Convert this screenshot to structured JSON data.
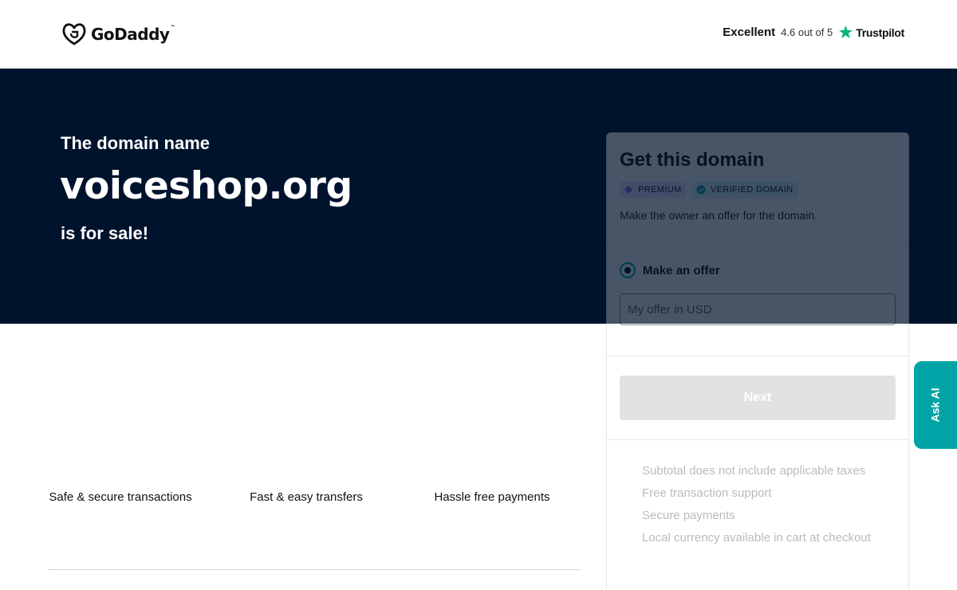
{
  "header": {
    "logo_text": "GoDaddy",
    "logo_tm": "™",
    "rating_label": "Excellent",
    "rating_score": "4.6 out of 5",
    "trustpilot": "Trustpilot"
  },
  "hero": {
    "pre": "The domain name",
    "domain": "voiceshop.org",
    "post": "is for sale!"
  },
  "features": [
    "Safe & secure transactions",
    "Fast & easy transfers",
    "Hassle free payments"
  ],
  "card": {
    "title": "Get this domain",
    "badges": [
      "PREMIUM",
      "VERIFIED DOMAIN"
    ],
    "description": "Make the owner an offer for the domain.",
    "offer_label": "Make an offer",
    "offer_placeholder": "My offer in USD",
    "next_label": "Next",
    "notes": [
      "Subtotal does not include applicable taxes",
      "Free transaction support",
      "Secure payments",
      "Local currency available in cart at checkout"
    ]
  },
  "ask_ai": "Ask AI",
  "colors": {
    "hero_bg": "#00132d",
    "accent": "#00a4a6",
    "trustpilot_green": "#00b67a",
    "premium_badge": "#ede6ff",
    "verified_badge": "#d9f3f3"
  }
}
